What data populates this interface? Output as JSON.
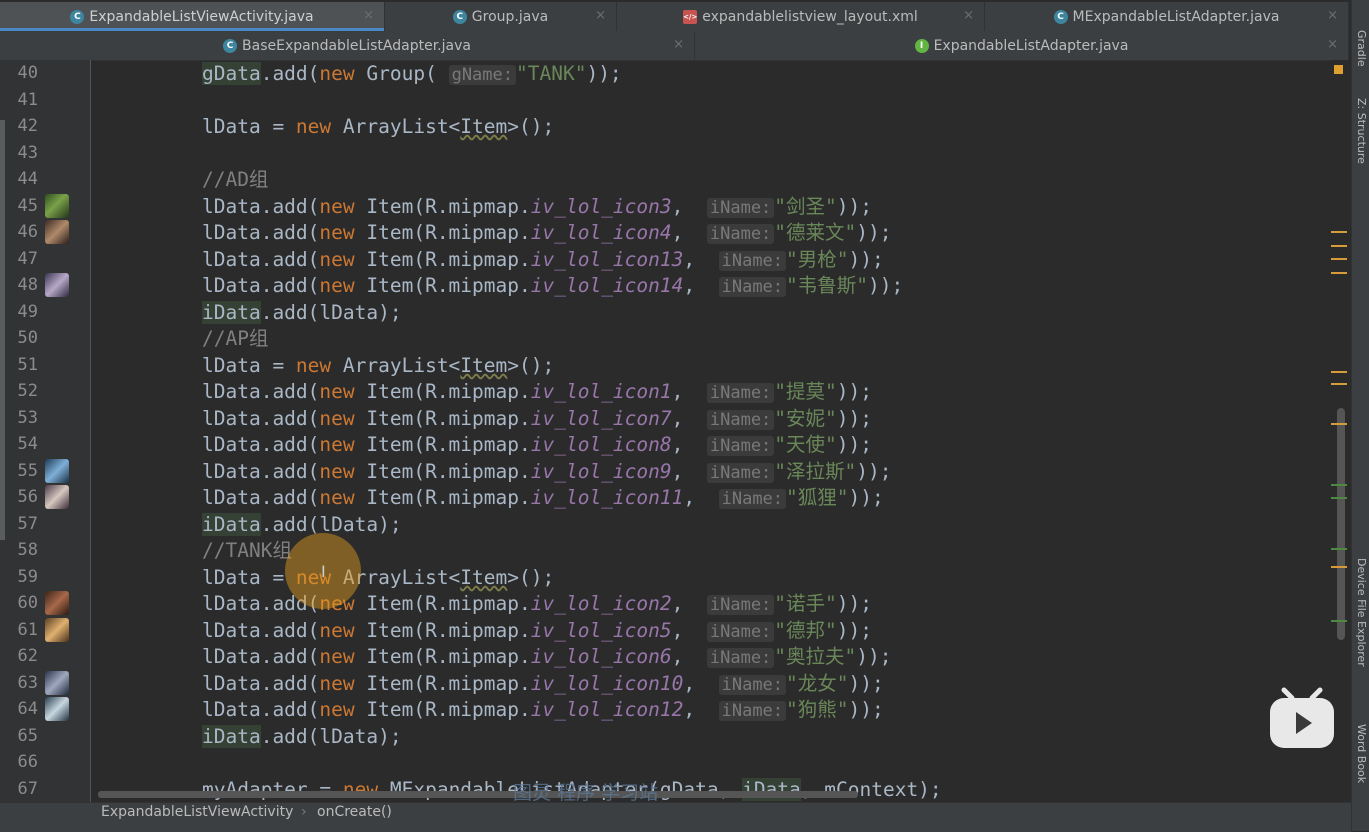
{
  "tabs_row1": [
    {
      "label": "ExpandableListViewActivity.java",
      "icon": "class-icon",
      "active": true
    },
    {
      "label": "Group.java",
      "icon": "class-icon",
      "active": false
    },
    {
      "label": "expandablelistview_layout.xml",
      "icon": "xml-file-icon",
      "active": false
    },
    {
      "label": "MExpandableListAdapter.java",
      "icon": "class-icon",
      "active": false
    }
  ],
  "tabs_row2": [
    {
      "label": "BaseExpandableListAdapter.java",
      "icon": "class-icon",
      "active": false
    },
    {
      "label": "ExpandableListAdapter.java",
      "icon": "interface-icon",
      "active": false
    }
  ],
  "icon_letters": {
    "class": "C",
    "interface": "I",
    "xml": "</>"
  },
  "close_glyph": "×",
  "line_numbers": [
    "40",
    "41",
    "42",
    "43",
    "44",
    "45",
    "46",
    "47",
    "48",
    "49",
    "50",
    "51",
    "52",
    "53",
    "54",
    "55",
    "56",
    "57",
    "58",
    "59",
    "60",
    "61",
    "62",
    "63",
    "64",
    "65",
    "66",
    "67"
  ],
  "code": {
    "l40": {
      "a": "gData",
      "b": ".add(",
      "kw": "new",
      "c": " Group(",
      "hint": "gName:",
      "str": "\"TANK\"",
      "d": "));"
    },
    "l42": {
      "a": "lData = ",
      "kw": "new",
      "c": " ArrayList<",
      "t": "Item",
      "d": ">();"
    },
    "l44": {
      "cmt": "//AD组"
    },
    "l45": {
      "a": "lData.add(",
      "kw": "new",
      "c": " Item(R.mipmap.",
      "fld": "iv_lol_icon3",
      "sep": ",",
      "hint": "iName:",
      "str": "\"剑圣\"",
      "d": "));"
    },
    "l46": {
      "a": "lData.add(",
      "kw": "new",
      "c": " Item(R.mipmap.",
      "fld": "iv_lol_icon4",
      "sep": ",",
      "hint": "iName:",
      "str": "\"德莱文\"",
      "d": "));"
    },
    "l47": {
      "a": "lData.add(",
      "kw": "new",
      "c": " Item(R.mipmap.",
      "fld": "iv_lol_icon13",
      "sep": ",",
      "hint": "iName:",
      "str": "\"男枪\"",
      "d": "));"
    },
    "l48": {
      "a": "lData.add(",
      "kw": "new",
      "c": " Item(R.mipmap.",
      "fld": "iv_lol_icon14",
      "sep": ",",
      "hint": "iName:",
      "str": "\"韦鲁斯\"",
      "d": "));"
    },
    "l49": {
      "a": "iData",
      "b": ".add(lData);"
    },
    "l50": {
      "cmt": "//AP组"
    },
    "l51": {
      "a": "lData = ",
      "kw": "new",
      "c": " ArrayList<",
      "t": "Item",
      "d": ">();"
    },
    "l52": {
      "a": "lData.add(",
      "kw": "new",
      "c": " Item(R.mipmap.",
      "fld": "iv_lol_icon1",
      "sep": ",",
      "hint": "iName:",
      "str": "\"提莫\"",
      "d": "));"
    },
    "l53": {
      "a": "lData.add(",
      "kw": "new",
      "c": " Item(R.mipmap.",
      "fld": "iv_lol_icon7",
      "sep": ",",
      "hint": "iName:",
      "str": "\"安妮\"",
      "d": "));"
    },
    "l54": {
      "a": "lData.add(",
      "kw": "new",
      "c": " Item(R.mipmap.",
      "fld": "iv_lol_icon8",
      "sep": ",",
      "hint": "iName:",
      "str": "\"天使\"",
      "d": "));"
    },
    "l55": {
      "a": "lData.add(",
      "kw": "new",
      "c": " Item(R.mipmap.",
      "fld": "iv_lol_icon9",
      "sep": ",",
      "hint": "iName:",
      "str": "\"泽拉斯\"",
      "d": "));"
    },
    "l56": {
      "a": "lData.add(",
      "kw": "new",
      "c": " Item(R.mipmap.",
      "fld": "iv_lol_icon11",
      "sep": ",",
      "hint": "iName:",
      "str": "\"狐狸\"",
      "d": "));"
    },
    "l57": {
      "a": "iData",
      "b": ".add(lData);"
    },
    "l58": {
      "cmt": "//TANK组"
    },
    "l59": {
      "a": "lData = ",
      "kw": "new",
      "c": " ArrayList<",
      "t": "Item",
      "d": ">();"
    },
    "l60": {
      "a": "lData.add(",
      "kw": "new",
      "c": " Item(R.mipmap.",
      "fld": "iv_lol_icon2",
      "sep": ",",
      "hint": "iName:",
      "str": "\"诺手\"",
      "d": "));"
    },
    "l61": {
      "a": "lData.add(",
      "kw": "new",
      "c": " Item(R.mipmap.",
      "fld": "iv_lol_icon5",
      "sep": ",",
      "hint": "iName:",
      "str": "\"德邦\"",
      "d": "));"
    },
    "l62": {
      "a": "lData.add(",
      "kw": "new",
      "c": " Item(R.mipmap.",
      "fld": "iv_lol_icon6",
      "sep": ",",
      "hint": "iName:",
      "str": "\"奥拉夫\"",
      "d": "));"
    },
    "l63": {
      "a": "lData.add(",
      "kw": "new",
      "c": " Item(R.mipmap.",
      "fld": "iv_lol_icon10",
      "sep": ",",
      "hint": "iName:",
      "str": "\"龙女\"",
      "d": "));"
    },
    "l64": {
      "a": "lData.add(",
      "kw": "new",
      "c": " Item(R.mipmap.",
      "fld": "iv_lol_icon12",
      "sep": ",",
      "hint": "iName:",
      "str": "\"狗熊\"",
      "d": "));"
    },
    "l65": {
      "a": "iData",
      "b": ".add(lData);"
    },
    "l67": {
      "a": "myAdapter = ",
      "kw": "new",
      "c": " MExpandableListAdapter(gData, ",
      "i": "iData",
      "d": ", mContext);"
    }
  },
  "breadcrumb": {
    "class": "ExpandableListViewActivity",
    "sep": "›",
    "method": "onCreate()"
  },
  "side_labels": {
    "gradle": "Gradle",
    "structure": "Z: Structure",
    "device": "Device File Explorer",
    "wordbook": "Word Book"
  },
  "watermark": "图灵 程序 学习站",
  "cursor_glyph": "I",
  "colors": {
    "keyword": "#cc7832",
    "field": "#9876aa",
    "string": "#6a8759",
    "comment": "#808080",
    "text": "#a9b7c6",
    "background": "#2b2b2b",
    "tab_accent": "#4a88c7"
  }
}
